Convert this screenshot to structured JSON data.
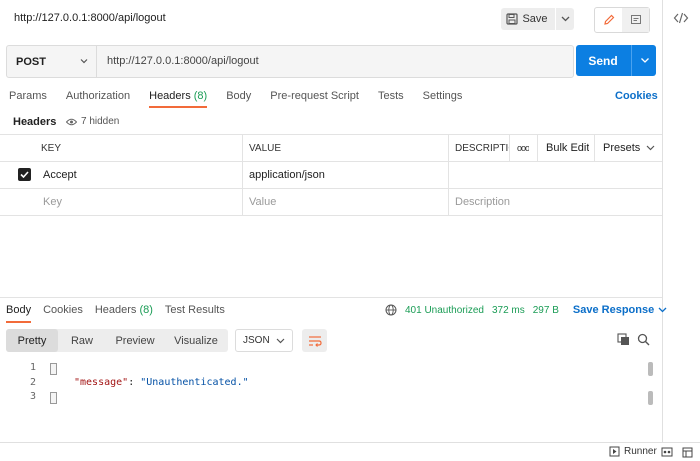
{
  "request": {
    "title": "http://127.0.0.1:8000/api/logout",
    "save_label": "Save",
    "method": "POST",
    "url": "http://127.0.0.1:8000/api/logout",
    "send_label": "Send"
  },
  "tabs": [
    {
      "label": "Params"
    },
    {
      "label": "Authorization"
    },
    {
      "label": "Headers",
      "count": "(8)",
      "active": true
    },
    {
      "label": "Body"
    },
    {
      "label": "Pre-request Script"
    },
    {
      "label": "Tests"
    },
    {
      "label": "Settings"
    }
  ],
  "cookies_label": "Cookies",
  "headers_section": {
    "title": "Headers",
    "hidden_label": "7 hidden",
    "columns": {
      "key": "KEY",
      "value": "VALUE",
      "description": "DESCRIPTION",
      "more": "ooo",
      "bulk_edit": "Bulk Edit",
      "presets": "Presets"
    },
    "rows": [
      {
        "key": "Accept",
        "value": "application/json",
        "description": "",
        "checked": true
      }
    ],
    "placeholder": {
      "key": "Key",
      "value": "Value",
      "description": "Description"
    }
  },
  "response": {
    "tabs": [
      {
        "label": "Body",
        "active": true
      },
      {
        "label": "Cookies"
      },
      {
        "label": "Headers",
        "count": "(8)"
      },
      {
        "label": "Test Results"
      }
    ],
    "status": "401 Unauthorized",
    "time": "372 ms",
    "size": "297 B",
    "save_response_label": "Save Response",
    "views": [
      "Pretty",
      "Raw",
      "Preview",
      "Visualize"
    ],
    "format": "JSON",
    "code_lines": [
      {
        "num": "1",
        "text": "{"
      },
      {
        "num": "2",
        "key": "\"message\"",
        "sep": ": ",
        "value": "\"Unauthenticated.\""
      },
      {
        "num": "3",
        "text": "}"
      }
    ]
  },
  "bottom": {
    "runner_label": "Runner"
  },
  "colors": {
    "accent": "#0c7fe2",
    "tab_underline": "#f26b3a",
    "status_green": "#1a9c55"
  }
}
